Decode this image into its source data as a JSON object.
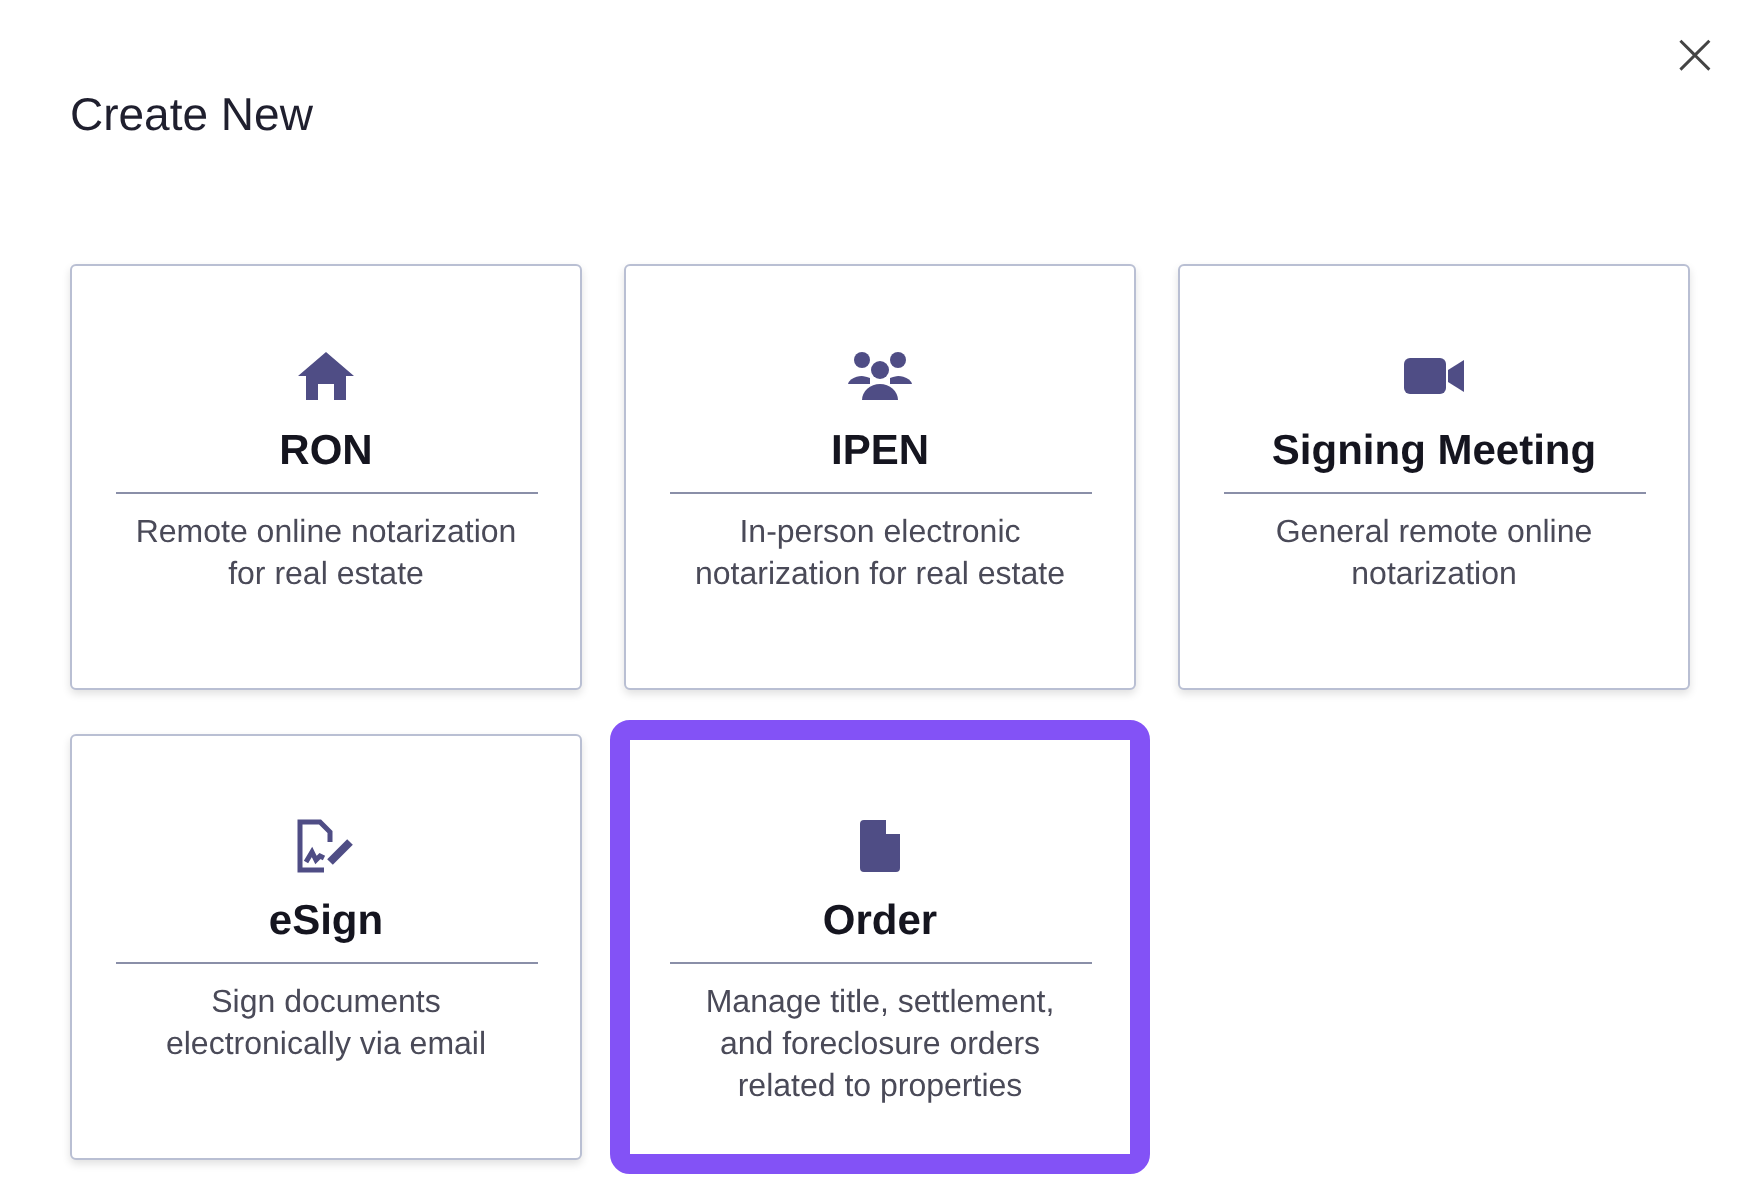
{
  "dialog": {
    "title": "Create New",
    "close_label": "×"
  },
  "options": [
    {
      "title": "RON",
      "description": "Remote online notarization for real estate",
      "selected": false
    },
    {
      "title": "IPEN",
      "description": "In-person electronic notarization for real estate",
      "selected": false
    },
    {
      "title": "Signing Meeting",
      "description": "General remote online notarization",
      "selected": false
    },
    {
      "title": "eSign",
      "description": "Sign documents electronically via email",
      "selected": false
    },
    {
      "title": "Order",
      "description": "Manage title, settlement, and foreclosure orders related to properties",
      "selected": true
    }
  ]
}
